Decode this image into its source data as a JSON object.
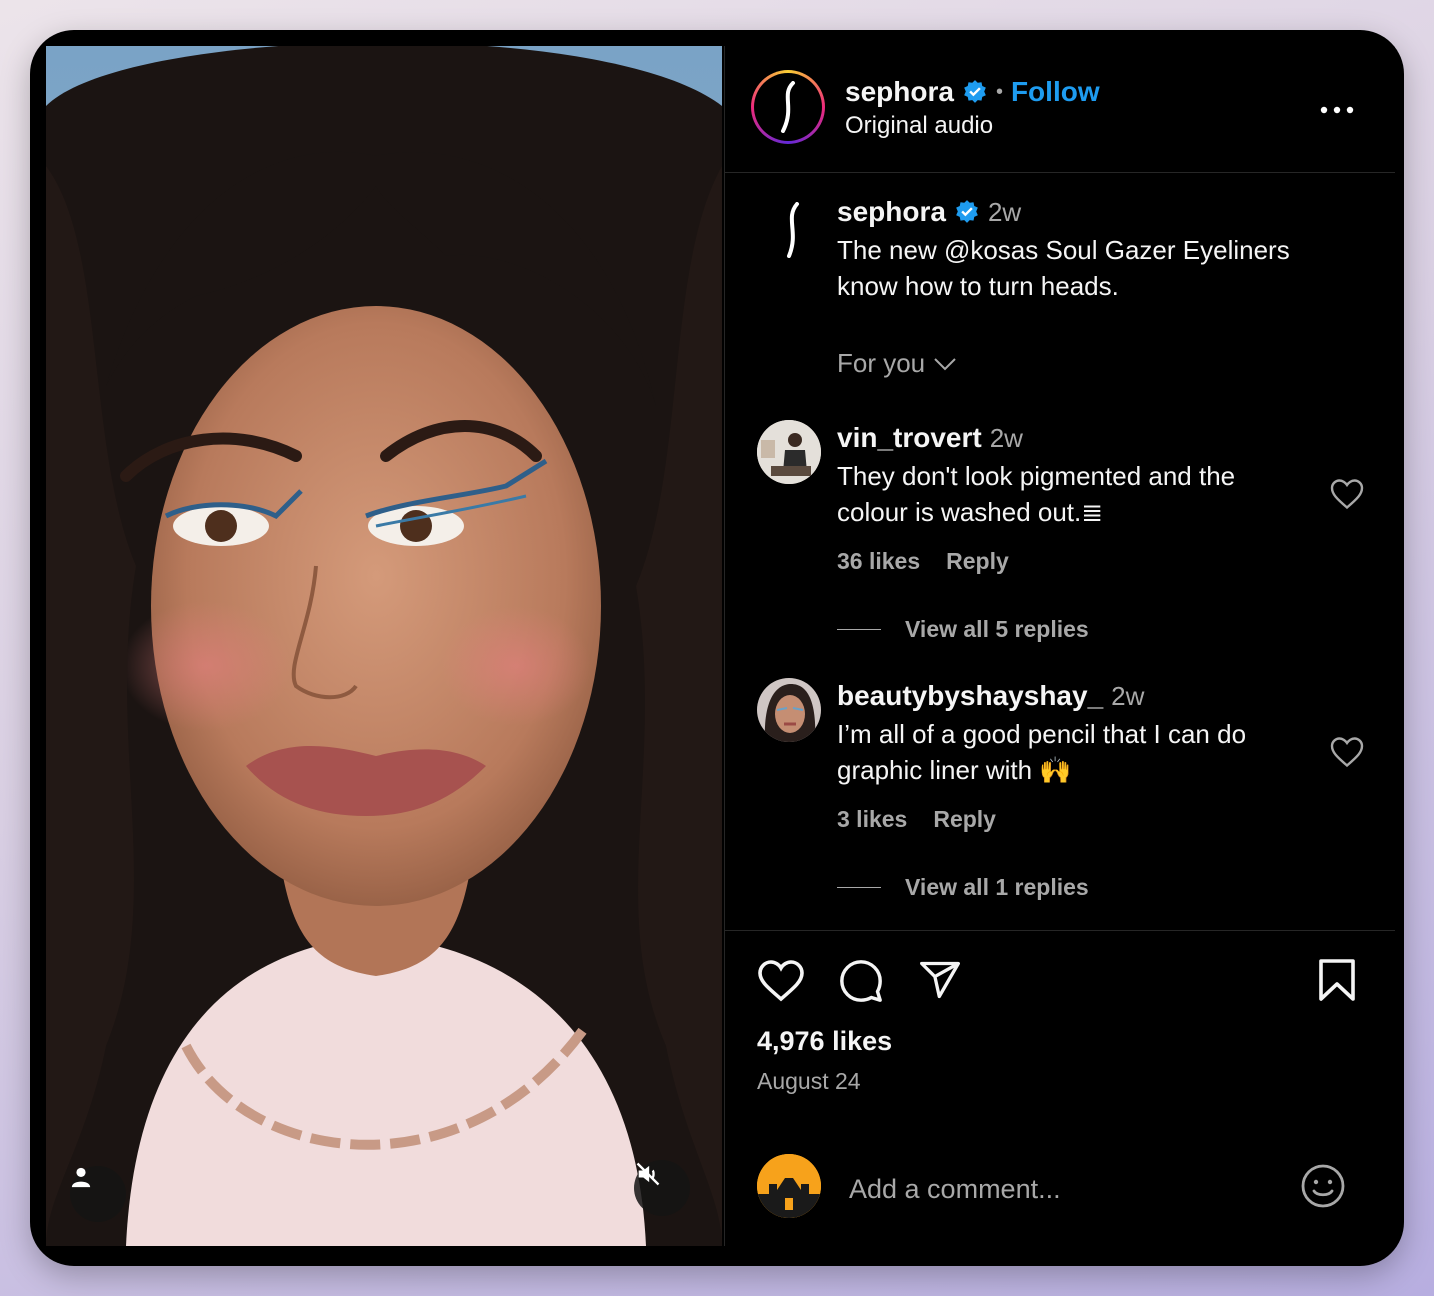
{
  "post": {
    "author": "sephora",
    "follow_label": "Follow",
    "audio": "Original audio",
    "caption_time": "2w",
    "caption": "The new @kosas Soul Gazer Eyeliners know how to turn heads.",
    "sort_label": "For you"
  },
  "comments": [
    {
      "user": "vin_trovert",
      "time": "2w",
      "text": "They don't look pigmented and the colour is washed out.",
      "trailing_glyph": "≣",
      "likes": "36 likes",
      "reply": "Reply",
      "view_replies": "View all 5 replies"
    },
    {
      "user": "beautybyshayshay_",
      "time": "2w",
      "text": "I’m all of a good pencil that I can do graphic liner with 🙌",
      "likes": "3 likes",
      "reply": "Reply",
      "view_replies": "View all 1 replies"
    }
  ],
  "stats": {
    "likes": "4,976 likes",
    "date": "August 24"
  },
  "composer": {
    "placeholder": "Add a comment..."
  },
  "colors": {
    "accent": "#1e9cf0",
    "panel_bg": "#000000",
    "muted_text": "#a8a8a8"
  },
  "icons": [
    "verified-badge-icon",
    "more-options-icon",
    "chevron-down-icon",
    "heart-icon",
    "comment-icon",
    "share-icon",
    "bookmark-icon",
    "emoji-icon",
    "user-tag-icon",
    "muted-speaker-icon"
  ]
}
